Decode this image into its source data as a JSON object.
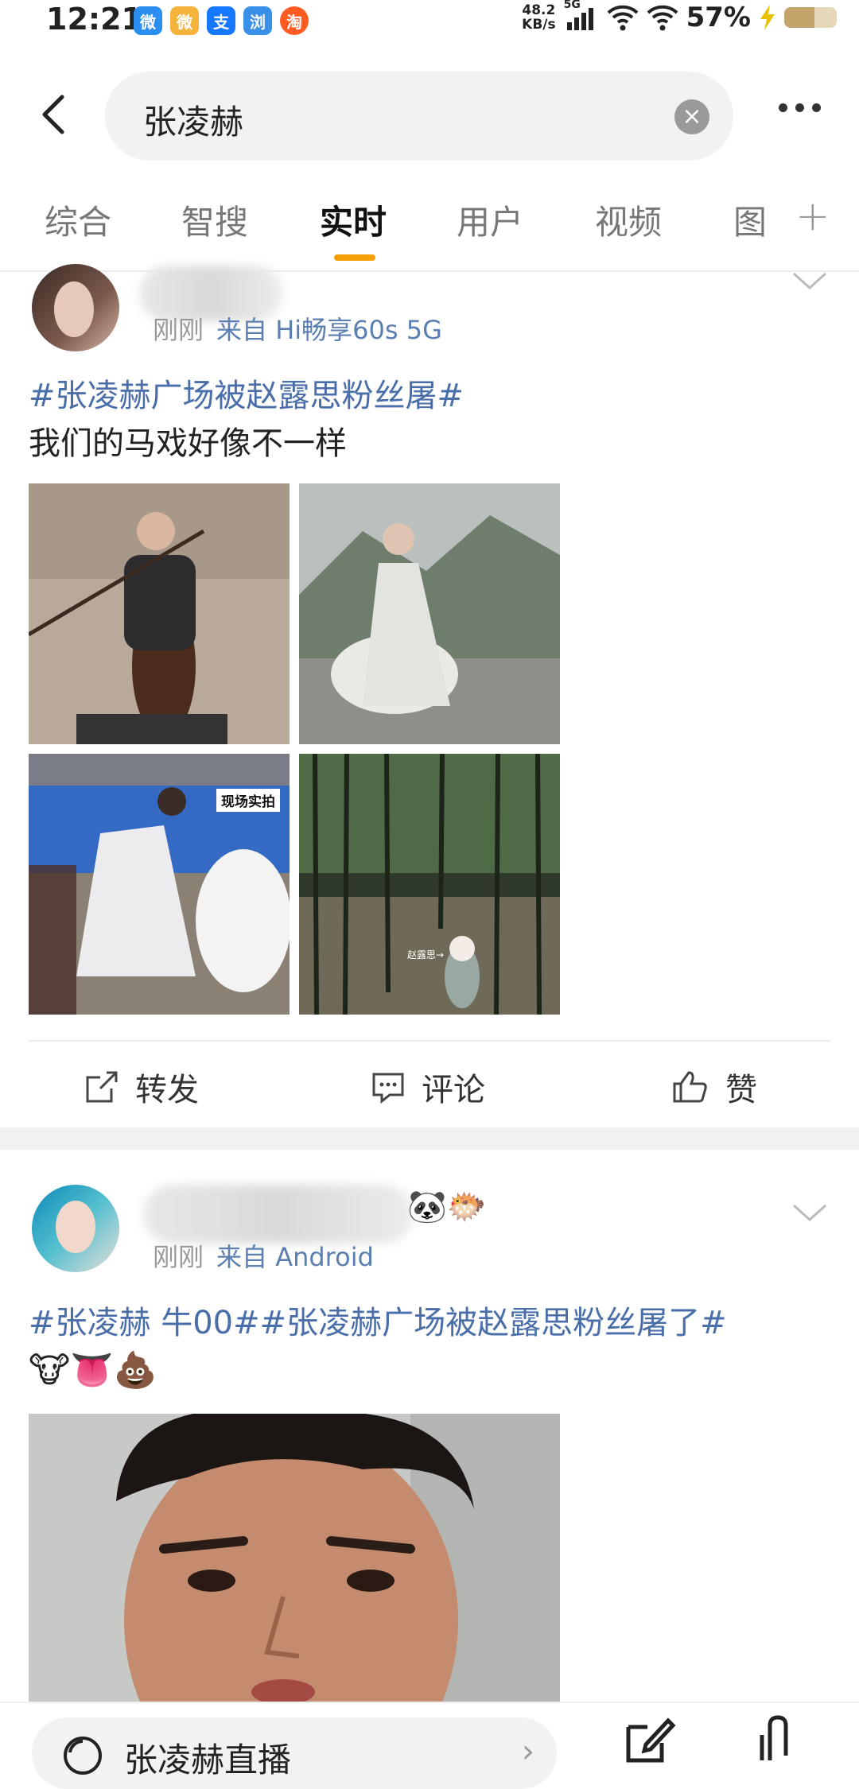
{
  "status_bar": {
    "time": "12:21",
    "net_speed_value": "48.2",
    "net_speed_unit": "KB/s",
    "network": "5G",
    "battery": "57%",
    "battery_level": 0.57,
    "apps": [
      "weibo-alt",
      "weibo",
      "alipay",
      "browser",
      "taobao"
    ],
    "app_glyphs": [
      "微",
      "微",
      "支",
      "浏",
      "淘"
    ]
  },
  "search": {
    "query": "张凌赫"
  },
  "tabs": [
    {
      "label": "综合"
    },
    {
      "label": "智搜"
    },
    {
      "label": "实时",
      "active": true
    },
    {
      "label": "用户"
    },
    {
      "label": "视频"
    },
    {
      "label": "图"
    }
  ],
  "tab_add": "+",
  "posts": [
    {
      "time": "刚刚",
      "source": "来自 Hi畅享60s 5G",
      "hashtag": "#张凌赫广场被赵露思粉丝屠#",
      "text": "我们的马戏好像不一样",
      "image_label": "现场实拍",
      "image_caption": "赵露思→",
      "actions": {
        "repost": "转发",
        "comment": "评论",
        "like": "赞"
      }
    },
    {
      "time": "刚刚",
      "source": "来自 Android",
      "name_emojis": "🐼🐡",
      "hashtag_line": "#张凌赫 牛00##张凌赫广场被赵露思粉丝屠了#",
      "emojis": "🐮👅💩"
    }
  ],
  "bottom": {
    "live": "张凌赫直播",
    "arrow": "›"
  }
}
